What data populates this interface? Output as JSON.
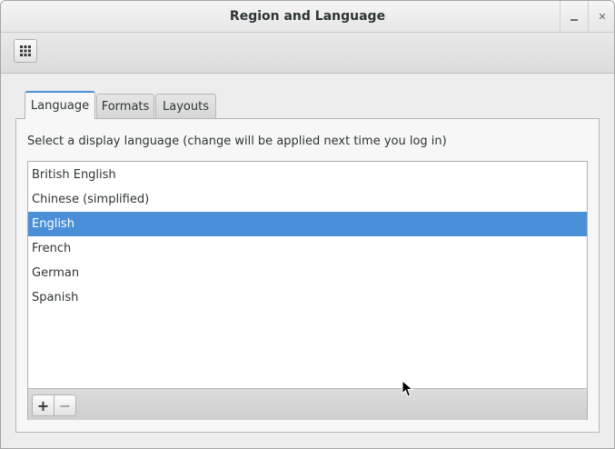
{
  "window": {
    "title": "Region and Language",
    "minimize_icon": "minimize-icon",
    "close_icon": "close-icon",
    "close_glyph": "✕"
  },
  "toolbar": {
    "app_grid_icon": "app-grid-icon"
  },
  "tabs": [
    {
      "label": "Language",
      "active": true
    },
    {
      "label": "Formats",
      "active": false
    },
    {
      "label": "Layouts",
      "active": false
    }
  ],
  "language_panel": {
    "instruction": "Select a display language (change will be applied next time you log in)",
    "languages": [
      {
        "label": "British English",
        "selected": false
      },
      {
        "label": "Chinese (simplified)",
        "selected": false
      },
      {
        "label": "English",
        "selected": true
      },
      {
        "label": "French",
        "selected": false
      },
      {
        "label": "German",
        "selected": false
      },
      {
        "label": "Spanish",
        "selected": false
      }
    ],
    "add_label": "+",
    "remove_label": "−"
  },
  "colors": {
    "selection": "#4a90d9",
    "window_bg": "#ededed"
  }
}
